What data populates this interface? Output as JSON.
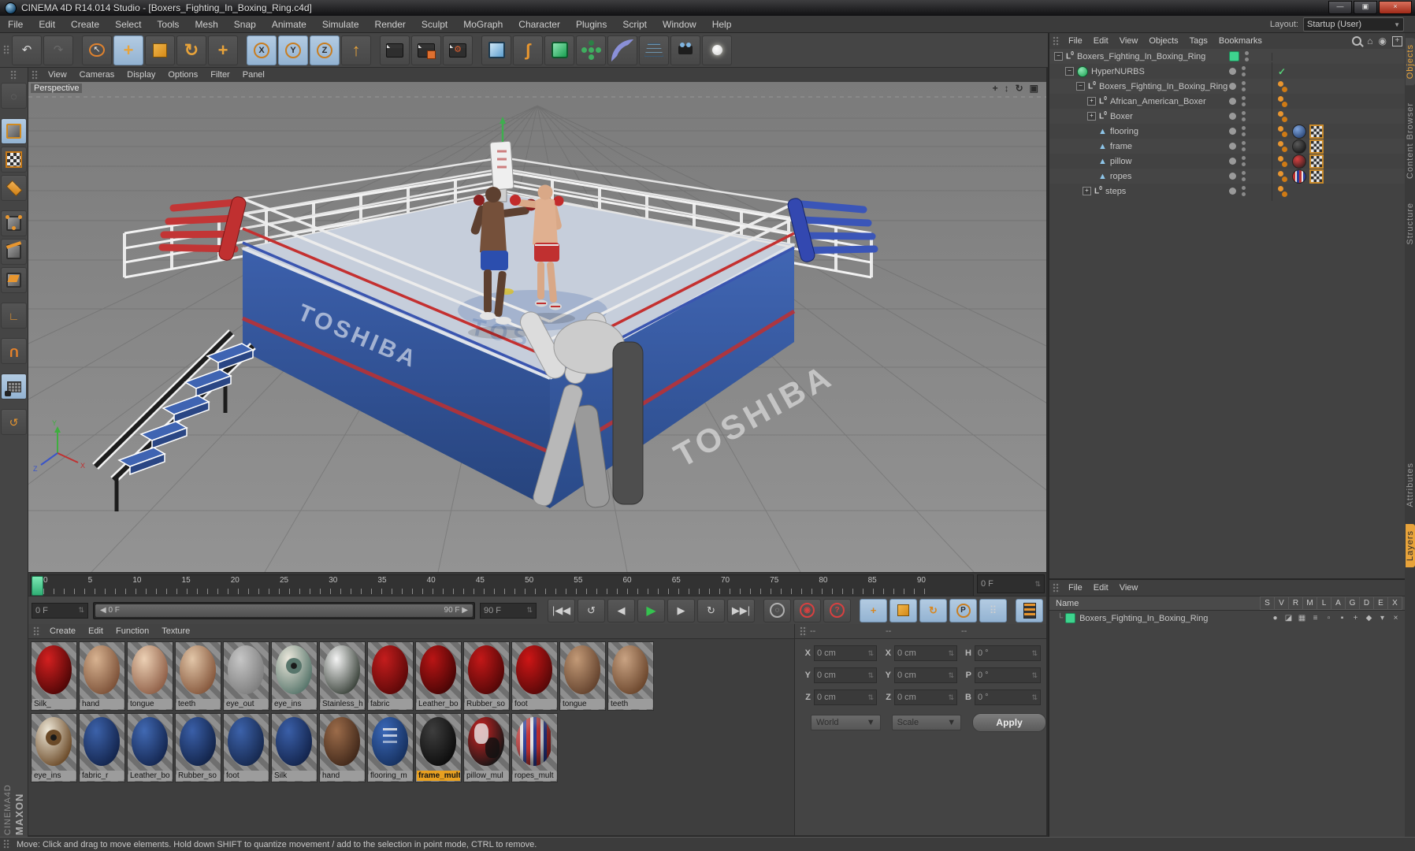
{
  "window": {
    "title": "CINEMA 4D R14.014 Studio - [Boxers_Fighting_In_Boxing_Ring.c4d]",
    "buttons": {
      "minimize": "—",
      "maximize": "▣",
      "close": "×"
    }
  },
  "menu_bar": {
    "items": [
      {
        "label": "File"
      },
      {
        "label": "Edit"
      },
      {
        "label": "Create"
      },
      {
        "label": "Select"
      },
      {
        "label": "Tools"
      },
      {
        "label": "Mesh"
      },
      {
        "label": "Snap"
      },
      {
        "label": "Animate"
      },
      {
        "label": "Simulate"
      },
      {
        "label": "Render"
      },
      {
        "label": "Sculpt"
      },
      {
        "label": "MoGraph"
      },
      {
        "label": "Character"
      },
      {
        "label": "Plugins"
      },
      {
        "label": "Script"
      },
      {
        "label": "Window"
      },
      {
        "label": "Help"
      }
    ],
    "layout_label": "Layout:",
    "layout_value": "Startup (User)"
  },
  "toolbar": {
    "accent": "#e8a33a",
    "items": [
      {
        "name": "undo-button",
        "cls": "g",
        "glyph": "↶",
        "color": "#d8d8d8"
      },
      {
        "name": "redo-button",
        "cls": "dim",
        "glyph": "↷",
        "color": "#888888"
      },
      {
        "name": "live-selection-tool",
        "cls": "ring gapL2",
        "glyph": "↖",
        "color": "#e8e8e8",
        "tilecls": "gapL"
      },
      {
        "name": "move-tool",
        "cls": "big",
        "glyph": "+",
        "color": "#e8a33a",
        "tilecls": "active"
      },
      {
        "name": "scale-tool",
        "cls": "sq",
        "glyph": "",
        "color": ""
      },
      {
        "name": "rotate-tool",
        "cls": "big",
        "glyph": "↻",
        "color": "#e8a33a"
      },
      {
        "name": "last-used-tool",
        "cls": "big",
        "glyph": "+",
        "color": "#e8a33a"
      },
      {
        "name": "x-axis-lock",
        "cls": "axis",
        "glyph": "X",
        "color": "",
        "tilecls": "active gapL"
      },
      {
        "name": "y-axis-lock",
        "cls": "axis",
        "glyph": "Y",
        "color": "",
        "tilecls": "active"
      },
      {
        "name": "z-axis-lock",
        "cls": "axis",
        "glyph": "Z",
        "color": "",
        "tilecls": "active"
      },
      {
        "name": "coordinate-system-button",
        "cls": "big",
        "glyph": "↑",
        "color": "#e8a33a"
      },
      {
        "name": "render-view-button",
        "cls": "clapper",
        "glyph": "",
        "color": "",
        "tilecls": "gapL"
      },
      {
        "name": "render-picture-viewer-button",
        "cls": "clapper pv",
        "glyph": "",
        "color": ""
      },
      {
        "name": "render-settings-button",
        "cls": "clapper",
        "glyph": "⚙",
        "color": ""
      },
      {
        "name": "add-cube-button",
        "cls": "cube",
        "glyph": "",
        "color": "",
        "tilecls": "gapL"
      },
      {
        "name": "add-spline-button",
        "cls": "big",
        "glyph": "ʃ",
        "color": "#e8962f"
      },
      {
        "name": "add-hypernurbs-button",
        "cls": "hnicon",
        "glyph": "",
        "color": ""
      },
      {
        "name": "add-mograph-button",
        "cls": "flower",
        "glyph": "",
        "color": ""
      },
      {
        "name": "add-deformer-button",
        "cls": "bendicon",
        "glyph": "",
        "color": ""
      },
      {
        "name": "add-floor-button",
        "cls": "flooricon",
        "glyph": "",
        "color": ""
      },
      {
        "name": "add-camera-button",
        "cls": "camicon",
        "glyph": "",
        "color": ""
      },
      {
        "name": "add-light-button",
        "cls": "bulbicon",
        "glyph": "",
        "color": ""
      }
    ]
  },
  "palette": {
    "items": [
      {
        "name": "make-editable-button",
        "cls": "g",
        "glyph": "◌",
        "color": "#777777"
      },
      {
        "name": "model-mode-button",
        "cls": "cubeg",
        "glyph": "",
        "color": "",
        "tilecls": "active gapT"
      },
      {
        "name": "texture-mode-button",
        "cls": "checker",
        "glyph": "",
        "color": ""
      },
      {
        "name": "workplane-mode-button",
        "cls": "diamond",
        "glyph": "",
        "color": ""
      },
      {
        "name": "points-mode-button",
        "cls": "cubeg plain dots",
        "glyph": "",
        "color": "",
        "tilecls": "gapT"
      },
      {
        "name": "edges-mode-button",
        "cls": "cubeg plain edge",
        "glyph": "",
        "color": ""
      },
      {
        "name": "polygons-mode-button",
        "cls": "cubeg plain face",
        "glyph": "",
        "color": ""
      },
      {
        "name": "axis-mode-button",
        "cls": "g",
        "glyph": "∟",
        "color": "#e8962f",
        "tilecls": "gapT"
      },
      {
        "name": "snap-button",
        "cls": "magnet",
        "glyph": "U",
        "color": "#e8832a",
        "tilecls": "gapT"
      },
      {
        "name": "workplane-snap-button",
        "cls": "lockgrid",
        "glyph": "",
        "color": "",
        "tilecls": "active gapT"
      },
      {
        "name": "quantize-button",
        "cls": "g",
        "glyph": "↺",
        "color": "#e8962f",
        "tilecls": "gapT"
      }
    ]
  },
  "viewport": {
    "menu": [
      {
        "label": "View"
      },
      {
        "label": "Cameras"
      },
      {
        "label": "Display"
      },
      {
        "label": "Options"
      },
      {
        "label": "Filter"
      },
      {
        "label": "Panel"
      }
    ],
    "label": "Perspective",
    "corner_icons": [
      {
        "name": "viewport-pan-icon",
        "glyph": "+"
      },
      {
        "name": "viewport-zoom-icon",
        "glyph": "↕"
      },
      {
        "name": "viewport-rotate-icon",
        "glyph": "↻"
      },
      {
        "name": "viewport-toggle-icon",
        "glyph": "▣"
      }
    ],
    "scene_colors": {
      "mat": "#c6cedb",
      "apron": "#35549c",
      "rope_red": "#c43030",
      "rope_blue": "#3a55b0",
      "mat_logo_text": "TOSHIBA"
    }
  },
  "object_manager": {
    "menu": [
      {
        "label": "File"
      },
      {
        "label": "Edit"
      },
      {
        "label": "View"
      },
      {
        "label": "Objects"
      },
      {
        "label": "Tags"
      },
      {
        "label": "Bookmarks"
      }
    ],
    "tree": [
      {
        "name": "Boxers_Fighting_In_Boxing_Ring"
      },
      {
        "name": "HyperNURBS"
      },
      {
        "name": "Boxers_Fighting_In_Boxing_Ring"
      },
      {
        "name": "African_American_Boxer"
      },
      {
        "name": "Boxer"
      },
      {
        "name": "flooring"
      },
      {
        "name": "frame"
      },
      {
        "name": "pillow"
      },
      {
        "name": "ropes"
      },
      {
        "name": "steps"
      }
    ],
    "side_tabs": [
      {
        "label": "Objects",
        "cls": "activetab"
      },
      {
        "label": "Content Browser",
        "cls": ""
      },
      {
        "label": "Structure",
        "cls": ""
      }
    ]
  },
  "timeline": {
    "ticks": [
      {
        "t": "0"
      },
      {
        "t": "5"
      },
      {
        "t": "10"
      },
      {
        "t": "15"
      },
      {
        "t": "20"
      },
      {
        "t": "25"
      },
      {
        "t": "30"
      },
      {
        "t": "35"
      },
      {
        "t": "40"
      },
      {
        "t": "45"
      },
      {
        "t": "50"
      },
      {
        "t": "55"
      },
      {
        "t": "60"
      },
      {
        "t": "65"
      },
      {
        "t": "70"
      },
      {
        "t": "75"
      },
      {
        "t": "80"
      },
      {
        "t": "85"
      },
      {
        "t": "90"
      }
    ],
    "ruler_frame": "0 F",
    "current_frame": "0 F",
    "range_start": "◀ 0 F",
    "range_end": "90 F ▶",
    "end_frame": "90 F"
  },
  "transport": {
    "items": [
      {
        "name": "goto-start-button",
        "kind": "g",
        "glyph": "|◀◀",
        "tilecls": "gapL"
      },
      {
        "name": "play-backward-button",
        "kind": "g",
        "glyph": "↺"
      },
      {
        "name": "prev-frame-button",
        "kind": "g",
        "glyph": "◀"
      },
      {
        "name": "play-button",
        "kind": "green",
        "glyph": "▶"
      },
      {
        "name": "next-frame-button",
        "kind": "g",
        "glyph": "▶"
      },
      {
        "name": "loop-button",
        "kind": "g",
        "glyph": "↻"
      },
      {
        "name": "goto-end-button",
        "kind": "g",
        "glyph": "▶▶|"
      },
      {
        "name": "keyframe-selection-button",
        "kind": "circ",
        "glyph": "◌",
        "tilecls": "gapL"
      },
      {
        "name": "record-keyframe-button",
        "kind": "circ red",
        "glyph": "◉"
      },
      {
        "name": "autokeying-button",
        "kind": "circ red",
        "glyph": "?"
      },
      {
        "name": "record-position-toggle",
        "kind": "orange big",
        "glyph": "+",
        "tilecls": "active gapL"
      },
      {
        "name": "record-scale-toggle",
        "kind": "sqo",
        "glyph": "",
        "tilecls": "active"
      },
      {
        "name": "record-rotation-toggle",
        "kind": "orange",
        "glyph": "↻",
        "tilecls": "active"
      },
      {
        "name": "record-parameter-toggle",
        "kind": "pring",
        "glyph": "P",
        "tilecls": "active"
      },
      {
        "name": "record-pla-toggle",
        "kind": "g",
        "glyph": "⠿",
        "tilecls": "active"
      },
      {
        "name": "keyframe-mode-button",
        "kind": "film",
        "glyph": "",
        "tilecls": "active gapL"
      }
    ]
  },
  "materials": {
    "menu": [
      {
        "label": "Create"
      },
      {
        "label": "Edit"
      },
      {
        "label": "Function"
      },
      {
        "label": "Texture"
      }
    ],
    "row1": [
      {
        "name": "Silk_",
        "c1": "#d42020",
        "c2": "#4e0606",
        "kind": ""
      },
      {
        "name": "hand",
        "c1": "#d8b391",
        "c2": "#7c5138",
        "kind": ""
      },
      {
        "name": "tongue",
        "c1": "#ecd0b4",
        "c2": "#8f5f47",
        "kind": ""
      },
      {
        "name": "teeth",
        "c1": "#e2c6a8",
        "c2": "#85573c",
        "kind": ""
      },
      {
        "name": "eye_out",
        "c1": "#c6c6c6",
        "c2": "#7e7e7e",
        "kind": ""
      },
      {
        "name": "eye_ins",
        "c1": "#ece8dc",
        "c2": "#57756b",
        "kind": "eye"
      },
      {
        "name": "Stainless_h",
        "c1": "#f4f4f4",
        "c2": "#3c443c",
        "kind": ""
      },
      {
        "name": "fabric",
        "c1": "#c41d1d",
        "c2": "#5c0808",
        "kind": ""
      },
      {
        "name": "Leather_bo",
        "c1": "#ba1515",
        "c2": "#470505",
        "kind": ""
      },
      {
        "name": "Rubber_so",
        "c1": "#c41818",
        "c2": "#520707",
        "kind": ""
      },
      {
        "name": "foot",
        "c1": "#ce1616",
        "c2": "#560808",
        "kind": ""
      },
      {
        "name": "tongue",
        "c1": "#c39a77",
        "c2": "#63422d",
        "kind": ""
      },
      {
        "name": "teeth",
        "c1": "#c9a383",
        "c2": "#6b462c",
        "kind": ""
      }
    ],
    "row2": [
      {
        "name": "eye_ins",
        "c1": "#eee8d8",
        "c2": "#6b4a28",
        "kind": "eye"
      },
      {
        "name": "fabric_r",
        "c1": "#3c62aa",
        "c2": "#13244c",
        "kind": ""
      },
      {
        "name": "Leather_bo",
        "c1": "#4169b3",
        "c2": "#142650",
        "kind": ""
      },
      {
        "name": "Rubber_so",
        "c1": "#3a5fa8",
        "c2": "#122348",
        "kind": ""
      },
      {
        "name": "foot",
        "c1": "#3c62aa",
        "c2": "#16284e",
        "kind": ""
      },
      {
        "name": "Silk",
        "c1": "#3a5fa8",
        "c2": "#13244c",
        "kind": ""
      },
      {
        "name": "hand",
        "c1": "#9c6c4a",
        "c2": "#41281a",
        "kind": ""
      },
      {
        "name": "flooring_m",
        "c1": "#3a68b8",
        "c2": "#16305e",
        "kind": "logo"
      },
      {
        "name": "frame_mult",
        "c1": "#3e3e3e",
        "c2": "#0c0c0c",
        "kind": "",
        "labelcls": "sel"
      },
      {
        "name": "pillow_mul",
        "c1": "#cc2424",
        "c2": "#151515",
        "kind": "patch"
      },
      {
        "name": "ropes_mult",
        "c1": "#c23030",
        "c2": "#2a3e9a",
        "kind": "stripes"
      }
    ]
  },
  "coordinates": {
    "headers": [
      {
        "h": "--"
      },
      {
        "h": "--"
      },
      {
        "h": "--"
      }
    ],
    "rows": [
      {
        "l1": "X",
        "v1": "0 cm",
        "l2": "X",
        "v2": "0 cm",
        "l3": "H",
        "v3": "0 °"
      },
      {
        "l1": "Y",
        "v1": "0 cm",
        "l2": "Y",
        "v2": "0 cm",
        "l3": "P",
        "v3": "0 °"
      },
      {
        "l1": "Z",
        "v1": "0 cm",
        "l2": "Z",
        "v2": "0 cm",
        "l3": "B",
        "v3": "0 °"
      }
    ],
    "dropdown_world": "World",
    "dropdown_scale": "Scale",
    "apply_label": "Apply",
    "spinner_glyph": "⇅"
  },
  "layer_panel": {
    "menu": [
      {
        "label": "File"
      },
      {
        "label": "Edit"
      },
      {
        "label": "View"
      }
    ],
    "name_header": "Name",
    "columns": [
      {
        "c": "S"
      },
      {
        "c": "V"
      },
      {
        "c": "R"
      },
      {
        "c": "M"
      },
      {
        "c": "L"
      },
      {
        "c": "A"
      },
      {
        "c": "G"
      },
      {
        "c": "D"
      },
      {
        "c": "E"
      },
      {
        "c": "X"
      }
    ],
    "row_name": "Boxers_Fighting_In_Boxing_Ring",
    "row_icons": [
      {
        "name": "solo-icon",
        "glyph": "●"
      },
      {
        "name": "viewport-visibility-icon",
        "glyph": "◪"
      },
      {
        "name": "render-visibility-icon",
        "glyph": "▦"
      },
      {
        "name": "manager-icon",
        "glyph": "≡"
      },
      {
        "name": "lock-icon",
        "glyph": "▫"
      },
      {
        "name": "animation-icon",
        "glyph": "▪"
      },
      {
        "name": "generators-icon",
        "glyph": "+"
      },
      {
        "name": "deformers-icon",
        "glyph": "◆"
      },
      {
        "name": "expressions-icon",
        "glyph": "▾"
      },
      {
        "name": "xref-icon",
        "glyph": "×"
      }
    ],
    "side_tabs": [
      {
        "label": "Attributes",
        "cls": ""
      },
      {
        "label": "Layers",
        "cls": "orangetab"
      }
    ]
  },
  "status_bar": {
    "text": "Move: Click and drag to move elements. Hold down SHIFT to quantize movement / add to the selection in point mode, CTRL to remove."
  },
  "branding": {
    "maxon": "MAXON",
    "cinema": "CINEMA4D"
  }
}
